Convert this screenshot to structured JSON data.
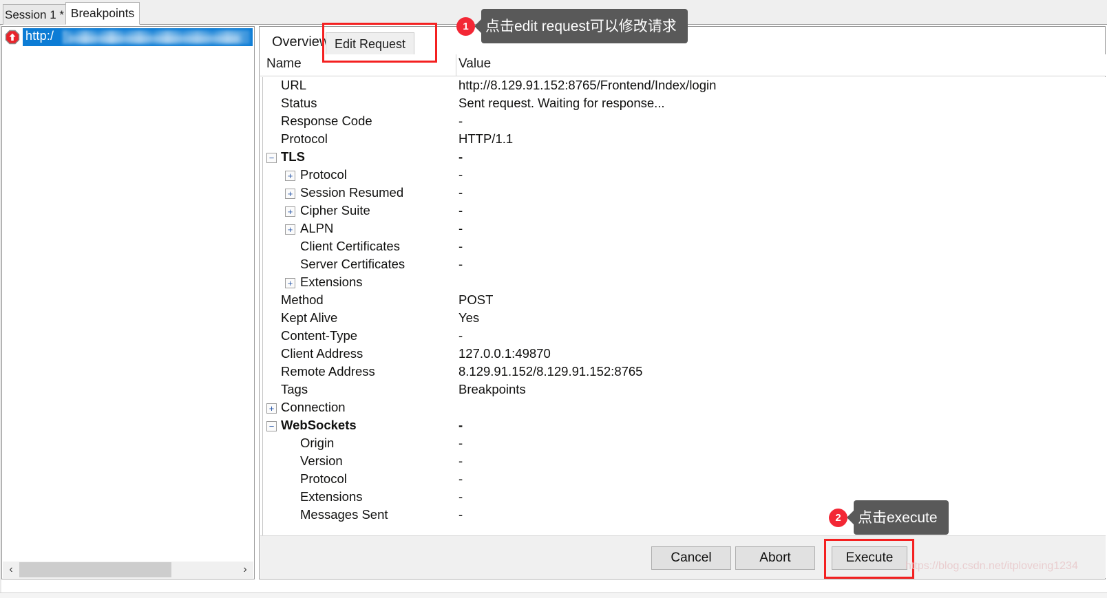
{
  "window": {
    "top_tabs": [
      {
        "label": "Session 1 *",
        "active": false
      },
      {
        "label": "Breakpoints",
        "active": true
      }
    ]
  },
  "session_list": {
    "selected_row": {
      "icon": "red-stop-breakpoint-icon",
      "url_prefix": "http:/",
      "redacted": true
    },
    "scrollbar": {
      "left_arrow": "‹",
      "right_arrow": "›",
      "thumb_percent": 70
    }
  },
  "inspector": {
    "tabs": [
      {
        "label": "Overview",
        "active": true
      },
      {
        "label": "Edit Request",
        "active": false
      }
    ],
    "columns": {
      "name": "Name",
      "value": "Value"
    },
    "expander_collapsed": "+",
    "expander_expanded": "−",
    "rows": [
      {
        "name": "URL",
        "value": "http://8.129.91.152:8765/Frontend/Index/login",
        "level": 0,
        "expander": null,
        "bold": false
      },
      {
        "name": "Status",
        "value": "Sent request. Waiting for response...",
        "level": 0,
        "expander": null,
        "bold": false
      },
      {
        "name": "Response Code",
        "value": "-",
        "level": 0,
        "expander": null,
        "bold": false
      },
      {
        "name": "Protocol",
        "value": "HTTP/1.1",
        "level": 0,
        "expander": null,
        "bold": false
      },
      {
        "name": "TLS",
        "value": "-",
        "level": 0,
        "expander": "expanded",
        "bold": true
      },
      {
        "name": "Protocol",
        "value": "-",
        "level": 1,
        "expander": "collapsed",
        "bold": false
      },
      {
        "name": "Session Resumed",
        "value": "-",
        "level": 1,
        "expander": "collapsed",
        "bold": false
      },
      {
        "name": "Cipher Suite",
        "value": "-",
        "level": 1,
        "expander": "collapsed",
        "bold": false
      },
      {
        "name": "ALPN",
        "value": "-",
        "level": 1,
        "expander": "collapsed",
        "bold": false
      },
      {
        "name": "Client Certificates",
        "value": "-",
        "level": 1,
        "expander": null,
        "bold": false
      },
      {
        "name": "Server Certificates",
        "value": "-",
        "level": 1,
        "expander": null,
        "bold": false
      },
      {
        "name": "Extensions",
        "value": "",
        "level": 1,
        "expander": "collapsed",
        "bold": false
      },
      {
        "name": "Method",
        "value": "POST",
        "level": 0,
        "expander": null,
        "bold": false
      },
      {
        "name": "Kept Alive",
        "value": "Yes",
        "level": 0,
        "expander": null,
        "bold": false
      },
      {
        "name": "Content-Type",
        "value": "-",
        "level": 0,
        "expander": null,
        "bold": false
      },
      {
        "name": "Client Address",
        "value": "127.0.0.1:49870",
        "level": 0,
        "expander": null,
        "bold": false
      },
      {
        "name": "Remote Address",
        "value": "8.129.91.152/8.129.91.152:8765",
        "level": 0,
        "expander": null,
        "bold": false
      },
      {
        "name": "Tags",
        "value": "Breakpoints",
        "level": 0,
        "expander": null,
        "bold": false
      },
      {
        "name": "Connection",
        "value": "",
        "level": 0,
        "expander": "collapsed",
        "bold": false
      },
      {
        "name": "WebSockets",
        "value": "-",
        "level": 0,
        "expander": "expanded",
        "bold": true
      },
      {
        "name": "Origin",
        "value": "-",
        "level": 1,
        "expander": null,
        "bold": false
      },
      {
        "name": "Version",
        "value": "-",
        "level": 1,
        "expander": null,
        "bold": false
      },
      {
        "name": "Protocol",
        "value": "-",
        "level": 1,
        "expander": null,
        "bold": false
      },
      {
        "name": "Extensions",
        "value": "-",
        "level": 1,
        "expander": null,
        "bold": false
      },
      {
        "name": "Messages Sent",
        "value": "-",
        "level": 1,
        "expander": null,
        "bold": false
      }
    ]
  },
  "buttons": {
    "cancel": "Cancel",
    "abort": "Abort",
    "execute": "Execute"
  },
  "annotations": [
    {
      "number": "1",
      "text": "点击edit request可以修改请求"
    },
    {
      "number": "2",
      "text": "点击execute"
    }
  ],
  "watermark": "https://blog.csdn.net/itploveing1234",
  "colors": {
    "selection_blue": "#0c7cd5",
    "annotation_red": "#f42020",
    "badge_red": "#f32735",
    "callout_gray": "#595959",
    "panel_gray": "#f0f0f0"
  }
}
